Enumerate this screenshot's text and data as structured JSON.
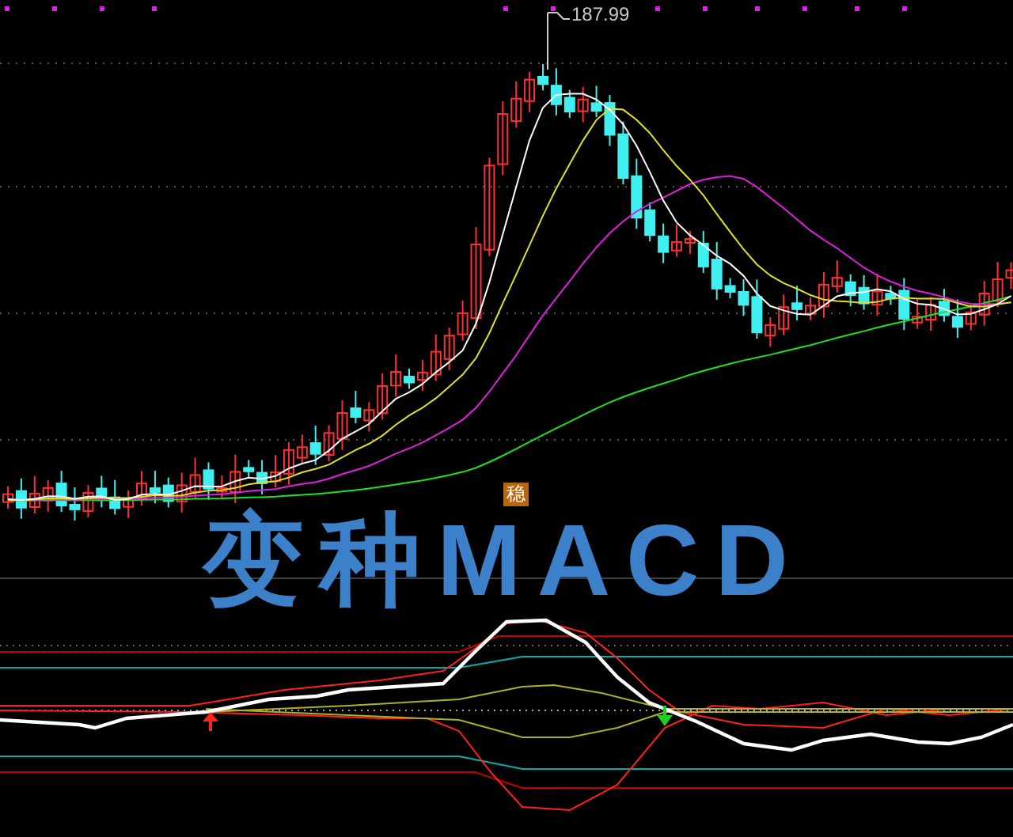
{
  "price_chart": {
    "high_label": "187.99",
    "signal_badge": "稳"
  },
  "overlay_title": "变种MACD"
}
